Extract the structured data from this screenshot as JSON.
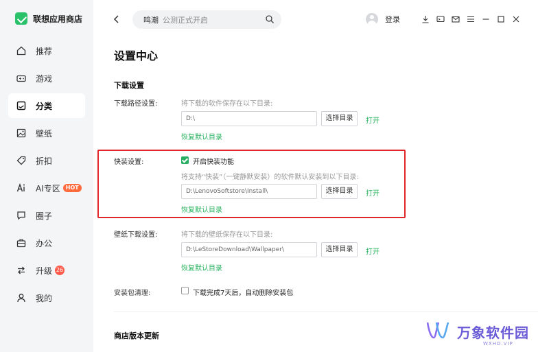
{
  "brand": {
    "name": "联想应用商店"
  },
  "nav": {
    "items": [
      {
        "label": "推荐",
        "icon": "home-icon"
      },
      {
        "label": "游戏",
        "icon": "gamepad-icon"
      },
      {
        "label": "分类",
        "icon": "category-icon",
        "active": true
      },
      {
        "label": "壁纸",
        "icon": "image-icon"
      },
      {
        "label": "折扣",
        "icon": "tag-icon"
      },
      {
        "label": "AI专区",
        "icon": "ai-icon",
        "badge": "HOT"
      },
      {
        "label": "圈子",
        "icon": "chat-icon"
      },
      {
        "label": "办公",
        "icon": "briefcase-icon"
      },
      {
        "label": "升级",
        "icon": "swap-icon",
        "count": "26"
      },
      {
        "label": "我的",
        "icon": "user-icon"
      }
    ]
  },
  "search": {
    "keyword": "鸣潮",
    "placeholder": "公测正式开启"
  },
  "user": {
    "login_label": "登录"
  },
  "page": {
    "title": "设置中心"
  },
  "download": {
    "section_title": "下载设置",
    "path_label": "下载路径设置:",
    "path_hint": "将下载的软件保存在以下目录:",
    "path_value": "D:\\",
    "choose_label": "选择目录",
    "open_label": "打开",
    "reset_label": "恢复默认目录"
  },
  "quick": {
    "label": "快装设置:",
    "enable_label": "开启快装功能",
    "hint": "将支持“快装”（一键静默安装）的软件默认安装到以下目录:",
    "path_value": "D:\\LenovoSoftstore\\Install\\",
    "choose_label": "选择目录",
    "open_label": "打开",
    "reset_label": "恢复默认目录"
  },
  "wallpaper": {
    "label": "壁纸下载设置:",
    "hint": "将下载的壁纸保存在以下目录:",
    "path_value": "D:\\LeStoreDownload\\Wallpaper\\",
    "choose_label": "选择目录",
    "open_label": "打开",
    "reset_label": "恢复默认目录"
  },
  "cleanup": {
    "label": "安装包清理:",
    "option_label": "下载完成7天后，自动删除安装包"
  },
  "update": {
    "section_title": "商店版本更新"
  },
  "watermark": {
    "text": "万象软件园",
    "sub": "WXHD.VIP"
  },
  "colors": {
    "accent": "#27ae60",
    "highlight": "#e0262b",
    "hot": "#ff6b3d"
  }
}
